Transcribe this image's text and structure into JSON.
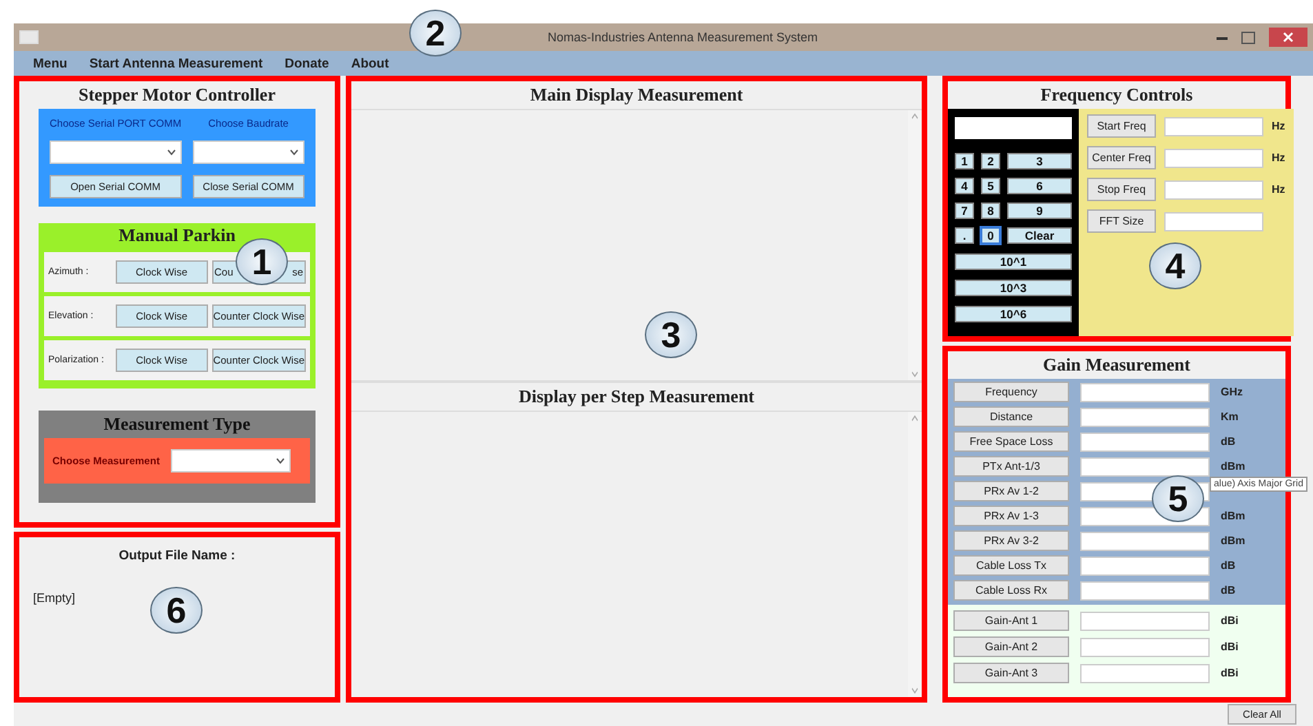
{
  "window": {
    "title": "Nomas-Industries Antenna Measurement System"
  },
  "menu": [
    "Menu",
    "Start Antenna Measurement",
    "Donate",
    "About"
  ],
  "stepper": {
    "title": "Stepper Motor Controller",
    "port_label": "Choose Serial PORT COMM",
    "baud_label": "Choose Baudrate",
    "buttons": [
      "Open Serial COMM",
      "Close Serial COMM"
    ]
  },
  "parking": {
    "title": "Manual Parkin",
    "rows": [
      {
        "label": "Azimuth :",
        "buttons": [
          {
            "label": "Clock Wise"
          },
          {
            "label": "Cou",
            "label_end": "se"
          }
        ]
      },
      {
        "label": "Elevation :",
        "buttons": [
          {
            "label": "Clock Wise"
          },
          {
            "label": "Counter Clock Wise"
          }
        ]
      },
      {
        "label": "Polarization :",
        "buttons": [
          {
            "label": "Clock Wise"
          },
          {
            "label": "Counter Clock Wise"
          }
        ]
      }
    ]
  },
  "measurement_type": {
    "title": "Measurement Type",
    "label": "Choose Measurement"
  },
  "output": {
    "title": "Output File Name :",
    "value": "[Empty]"
  },
  "main_display": {
    "title": "Main Display Measurement"
  },
  "step_display": {
    "title": "Display per Step Measurement"
  },
  "frequency": {
    "title": "Frequency Controls",
    "keypad": [
      {
        "label": "1",
        "kind": "key",
        "focused": false
      },
      {
        "label": "2",
        "kind": "key",
        "focused": false
      },
      {
        "label": "3",
        "kind": "key",
        "focused": false
      },
      {
        "label": "4",
        "kind": "key",
        "focused": false
      },
      {
        "label": "5",
        "kind": "key",
        "focused": false
      },
      {
        "label": "6",
        "kind": "key",
        "focused": false
      },
      {
        "label": "7",
        "kind": "key",
        "focused": false
      },
      {
        "label": "8",
        "kind": "key",
        "focused": false
      },
      {
        "label": "9",
        "kind": "key",
        "focused": false
      },
      {
        "label": ".",
        "kind": "key",
        "focused": false
      },
      {
        "label": "0",
        "kind": "key",
        "focused": true
      },
      {
        "label": "Clear",
        "kind": "key",
        "focused": false
      },
      {
        "label": "10^1",
        "kind": "wide",
        "focused": false
      },
      {
        "label": "10^3",
        "kind": "wide",
        "focused": false
      },
      {
        "label": "10^6",
        "kind": "wide",
        "focused": false
      }
    ],
    "rows": [
      {
        "label": "Start Freq",
        "unit": "Hz"
      },
      {
        "label": "Center Freq",
        "unit": "Hz"
      },
      {
        "label": "Stop Freq",
        "unit": "Hz"
      },
      {
        "label": "FFT Size"
      }
    ]
  },
  "gain": {
    "title": "Gain Measurement",
    "rows": [
      {
        "label": "Frequency",
        "unit": "GHz"
      },
      {
        "label": "Distance",
        "unit": "Km"
      },
      {
        "label": "Free Space Loss",
        "unit": "dB"
      },
      {
        "label": "PTx Ant-1/3",
        "unit": "dBm"
      },
      {
        "label": "PRx Av 1-2"
      },
      {
        "label": "PRx Av 1-3",
        "unit": "dBm"
      },
      {
        "label": "PRx Av 3-2",
        "unit": "dBm"
      },
      {
        "label": "Cable Loss Tx",
        "unit": "dB"
      },
      {
        "label": "Cable Loss Rx",
        "unit": "dB"
      }
    ],
    "antenna_rows": [
      {
        "label": "Gain-Ant 1",
        "unit": "dBi"
      },
      {
        "label": "Gain-Ant 2",
        "unit": "dBi"
      },
      {
        "label": "Gain-Ant 3",
        "unit": "dBi"
      }
    ]
  },
  "tooltip": "alue) Axis Major Grid",
  "clear_button": "Clear All",
  "annotations": [
    "1",
    "2",
    "3",
    "4",
    "5",
    "6"
  ]
}
